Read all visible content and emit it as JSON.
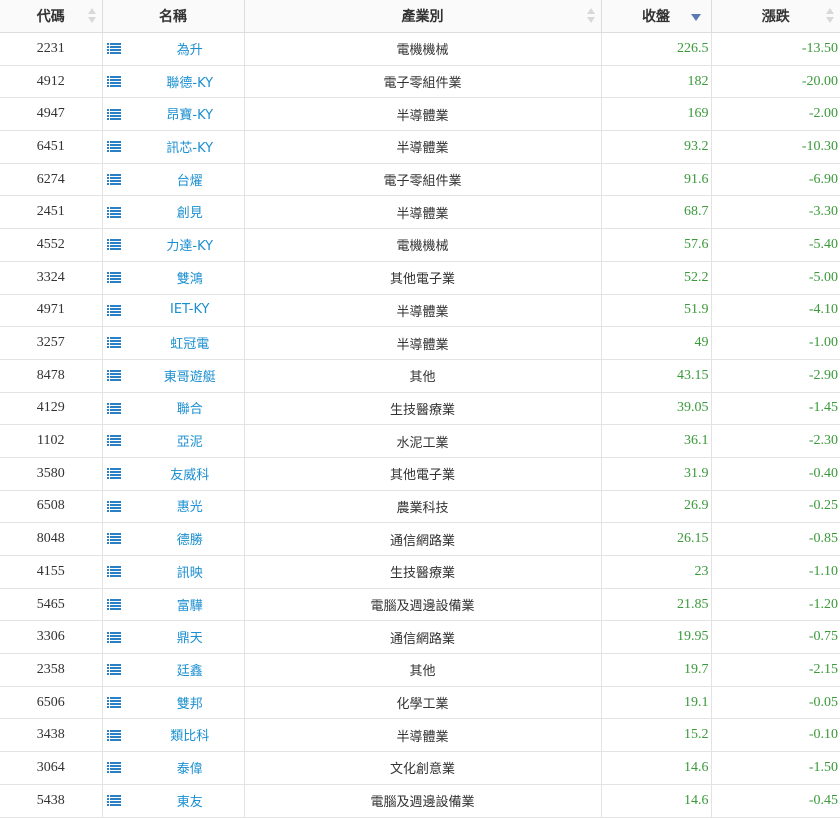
{
  "headers": {
    "code": "代碼",
    "name": "名稱",
    "industry": "產業別",
    "close": "收盤",
    "change": "漲跌"
  },
  "accent_link_color": "#1a8fd0",
  "value_color": "#3a9a3a",
  "icon_name": "list-icon",
  "rows": [
    {
      "code": "2231",
      "name": "為升",
      "industry": "電機機械",
      "close": "226.5",
      "change": "-13.50"
    },
    {
      "code": "4912",
      "name": "聯德-KY",
      "industry": "電子零組件業",
      "close": "182",
      "change": "-20.00"
    },
    {
      "code": "4947",
      "name": "昂寶-KY",
      "industry": "半導體業",
      "close": "169",
      "change": "-2.00"
    },
    {
      "code": "6451",
      "name": "訊芯-KY",
      "industry": "半導體業",
      "close": "93.2",
      "change": "-10.30"
    },
    {
      "code": "6274",
      "name": "台燿",
      "industry": "電子零組件業",
      "close": "91.6",
      "change": "-6.90"
    },
    {
      "code": "2451",
      "name": "創見",
      "industry": "半導體業",
      "close": "68.7",
      "change": "-3.30"
    },
    {
      "code": "4552",
      "name": "力達-KY",
      "industry": "電機機械",
      "close": "57.6",
      "change": "-5.40"
    },
    {
      "code": "3324",
      "name": "雙鴻",
      "industry": "其他電子業",
      "close": "52.2",
      "change": "-5.00"
    },
    {
      "code": "4971",
      "name": "IET-KY",
      "industry": "半導體業",
      "close": "51.9",
      "change": "-4.10"
    },
    {
      "code": "3257",
      "name": "虹冠電",
      "industry": "半導體業",
      "close": "49",
      "change": "-1.00"
    },
    {
      "code": "8478",
      "name": "東哥遊艇",
      "industry": "其他",
      "close": "43.15",
      "change": "-2.90"
    },
    {
      "code": "4129",
      "name": "聯合",
      "industry": "生技醫療業",
      "close": "39.05",
      "change": "-1.45"
    },
    {
      "code": "1102",
      "name": "亞泥",
      "industry": "水泥工業",
      "close": "36.1",
      "change": "-2.30"
    },
    {
      "code": "3580",
      "name": "友威科",
      "industry": "其他電子業",
      "close": "31.9",
      "change": "-0.40"
    },
    {
      "code": "6508",
      "name": "惠光",
      "industry": "農業科技",
      "close": "26.9",
      "change": "-0.25"
    },
    {
      "code": "8048",
      "name": "德勝",
      "industry": "通信網路業",
      "close": "26.15",
      "change": "-0.85"
    },
    {
      "code": "4155",
      "name": "訊映",
      "industry": "生技醫療業",
      "close": "23",
      "change": "-1.10"
    },
    {
      "code": "5465",
      "name": "富驊",
      "industry": "電腦及週邊設備業",
      "close": "21.85",
      "change": "-1.20"
    },
    {
      "code": "3306",
      "name": "鼎天",
      "industry": "通信網路業",
      "close": "19.95",
      "change": "-0.75"
    },
    {
      "code": "2358",
      "name": "廷鑫",
      "industry": "其他",
      "close": "19.7",
      "change": "-2.15"
    },
    {
      "code": "6506",
      "name": "雙邦",
      "industry": "化學工業",
      "close": "19.1",
      "change": "-0.05"
    },
    {
      "code": "3438",
      "name": "類比科",
      "industry": "半導體業",
      "close": "15.2",
      "change": "-0.10"
    },
    {
      "code": "3064",
      "name": "泰偉",
      "industry": "文化創意業",
      "close": "14.6",
      "change": "-1.50"
    },
    {
      "code": "5438",
      "name": "東友",
      "industry": "電腦及週邊設備業",
      "close": "14.6",
      "change": "-0.45"
    }
  ]
}
